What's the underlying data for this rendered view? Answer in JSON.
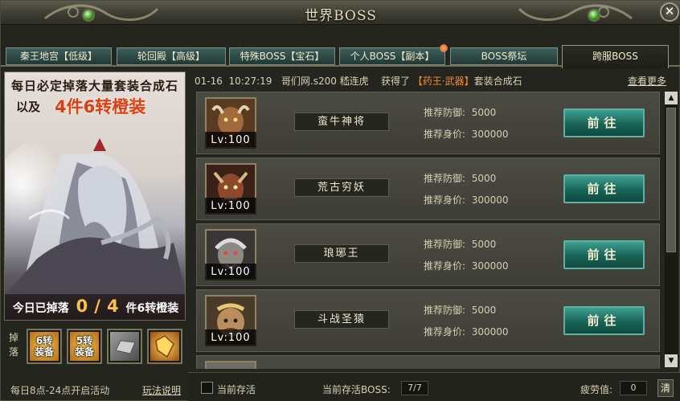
{
  "window": {
    "title": "世界BOSS",
    "close_label": "✕"
  },
  "tabs": [
    {
      "label": "秦王地宫【低级】",
      "active": false
    },
    {
      "label": "轮回殿【高级】",
      "active": false
    },
    {
      "label": "特殊BOSS【宝石】",
      "active": false
    },
    {
      "label": "个人BOSS【副本】",
      "active": false,
      "has_dot": true
    },
    {
      "label": "BOSS祭坛",
      "active": false
    },
    {
      "label": "跨服BOSS",
      "active": true
    }
  ],
  "promo": {
    "line1": "每日必定掉落大量套装合成石",
    "line2": "以及",
    "line3": "4件6转橙装",
    "drop_prefix": "今日已掉落",
    "drop_current": "0",
    "drop_sep": "/",
    "drop_total": "4",
    "drop_suffix": "件6转橙装"
  },
  "drops": {
    "label": "掉落",
    "items": [
      {
        "text": "6转\n装备",
        "icon": "orange-equip-icon"
      },
      {
        "text": "5转\n装备",
        "icon": "orange-equip-icon"
      },
      {
        "text": "",
        "icon": "silver-ingot-icon"
      },
      {
        "text": "",
        "icon": "gold-crystal-icon"
      }
    ]
  },
  "activity_time": "每日8点-24点开启活动",
  "rules_link": "玩法说明",
  "news": {
    "date": "01-16",
    "time": "10:27:19",
    "player": "哥们网.s200 嵇连虎",
    "action": "获得了",
    "item": "【药王·武器】",
    "suffix": "套装合成石"
  },
  "more_link": "查看更多",
  "bosses": [
    {
      "name": "蛮牛神将",
      "level": "Lv:100",
      "def_label": "推荐防御:",
      "def": "5000",
      "worth_label": "推荐身价:",
      "worth": "300000",
      "button": "前往",
      "portrait": "bull"
    },
    {
      "name": "荒古穷妖",
      "level": "Lv:100",
      "def_label": "推荐防御:",
      "def": "5000",
      "worth_label": "推荐身价:",
      "worth": "300000",
      "button": "前往",
      "portrait": "demon"
    },
    {
      "name": "琅琊王",
      "level": "Lv:100",
      "def_label": "推荐防御:",
      "def": "5000",
      "worth_label": "推荐身价:",
      "worth": "300000",
      "button": "前往",
      "portrait": "king"
    },
    {
      "name": "斗战圣猿",
      "level": "Lv:100",
      "def_label": "推荐防御:",
      "def": "5000",
      "worth_label": "推荐身价:",
      "worth": "300000",
      "button": "前往",
      "portrait": "ape"
    }
  ],
  "footer": {
    "keep_label": "当前存活",
    "alive_label": "当前存活BOSS:",
    "alive_value": "7/7",
    "fatigue_label": "疲劳值:",
    "fatigue_value": "0",
    "clear_label": "清"
  },
  "colors": {
    "accent_orange": "#f28b2b",
    "button_teal": "#196356",
    "promo_red": "#e33d0f"
  }
}
